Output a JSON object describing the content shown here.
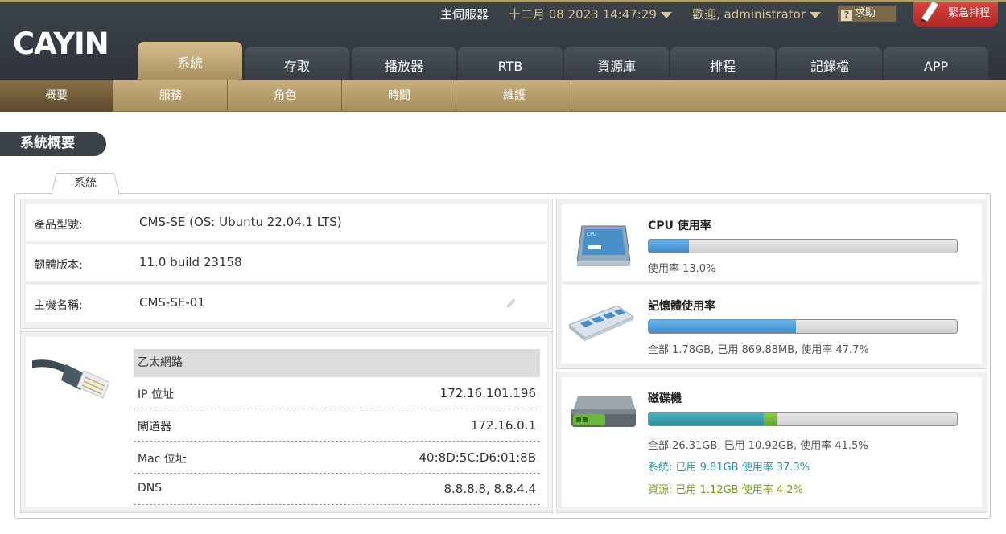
{
  "header": {
    "logo_text": "CAYIN",
    "server_label": "主伺服器",
    "datetime": "十二月 08 2023 14:47:29",
    "welcome": "歡迎, administrator",
    "help_label": "求助",
    "emergency_label": "緊急排程"
  },
  "main_tabs": [
    {
      "label": "系統",
      "active": true
    },
    {
      "label": "存取"
    },
    {
      "label": "播放器"
    },
    {
      "label": "RTB"
    },
    {
      "label": "資源庫"
    },
    {
      "label": "排程"
    },
    {
      "label": "記錄檔"
    },
    {
      "label": "APP"
    }
  ],
  "sub_tabs": [
    {
      "label": "概要",
      "active": true
    },
    {
      "label": "服務"
    },
    {
      "label": "角色"
    },
    {
      "label": "時間"
    },
    {
      "label": "維護"
    }
  ],
  "page_title": "系統概要",
  "panel_tab": "系統",
  "info": [
    {
      "label": "產品型號:",
      "value": "CMS-SE (OS: Ubuntu 22.04.1 LTS)"
    },
    {
      "label": "韌體版本:",
      "value": "11.0 build 23158"
    },
    {
      "label": "主機名稱:",
      "value": "CMS-SE-01"
    }
  ],
  "network": {
    "title": "乙太網路",
    "rows": [
      {
        "label": "IP 位址",
        "value": "172.16.101.196"
      },
      {
        "label": "閘道器",
        "value": "172.16.0.1"
      },
      {
        "label": "Mac 位址",
        "value": "40:8D:5C:D6:01:8B"
      },
      {
        "label": "DNS",
        "value": "8.8.8.8, 8.8.4.4"
      }
    ]
  },
  "cpu": {
    "title": "CPU 使用率",
    "usage_percent": 13.0,
    "text": "使用率 13.0%"
  },
  "memory": {
    "title": "記憶體使用率",
    "usage_percent": 47.7,
    "text": "全部 1.78GB, 已用 869.88MB, 使用率 47.7%"
  },
  "disk": {
    "title": "磁碟機",
    "system_percent": 37.3,
    "resource_percent": 4.2,
    "text": "全部 26.31GB, 已用 10.92GB, 使用率 41.5%",
    "system_text": "系統: 已用 9.81GB 使用率 37.3%",
    "resource_text": "資源: 已用 1.12GB 使用率 4.2%"
  },
  "colors": {
    "header_bg": "#353b42",
    "accent_gold": "#b59d6c",
    "bar_blue": "#3d8ccc",
    "bar_teal": "#2c8e9c",
    "bar_green": "#5ea52a",
    "emergency_red": "#c3302c"
  }
}
